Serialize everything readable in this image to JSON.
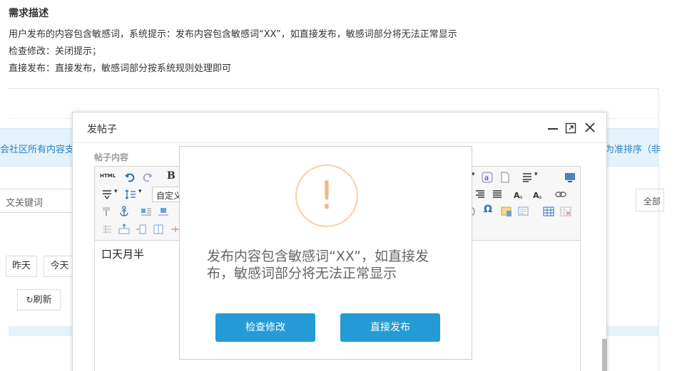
{
  "requirement": {
    "title": "需求描述",
    "line1": "用户发布的内容包含敏感词，系统提示：发布内容包含敏感词“XX”，如直接发布，敏感词部分将无法正常显示",
    "line2": "检查修改：关闭提示；",
    "line3": "直接发布：直接发布，敏感词部分按系统规则处理即可"
  },
  "background": {
    "band_left": "会社区所有内容支",
    "band_right": "为准排序（非",
    "keyword_placeholder": "文关键词",
    "all_label": "全部",
    "btn_yesterday": "昨天",
    "btn_today": "今天",
    "btn_refresh": "刷新"
  },
  "dialog": {
    "title": "发帖子",
    "field_label": "帖子内容",
    "toolbar": {
      "html_label": "HTML",
      "bold_label": "B",
      "font_select_value": "自定义",
      "omega_label": "Ω"
    },
    "editor_content": "口天月半"
  },
  "alert": {
    "icon_glyph": "!",
    "message": "发布内容包含敏感词“XX”，如直接发布，敏感词部分将无法正常显示",
    "btn_check": "检查修改",
    "btn_publish": "直接发布",
    "accent_color": "#249bd6",
    "icon_color": "#f2b786"
  }
}
